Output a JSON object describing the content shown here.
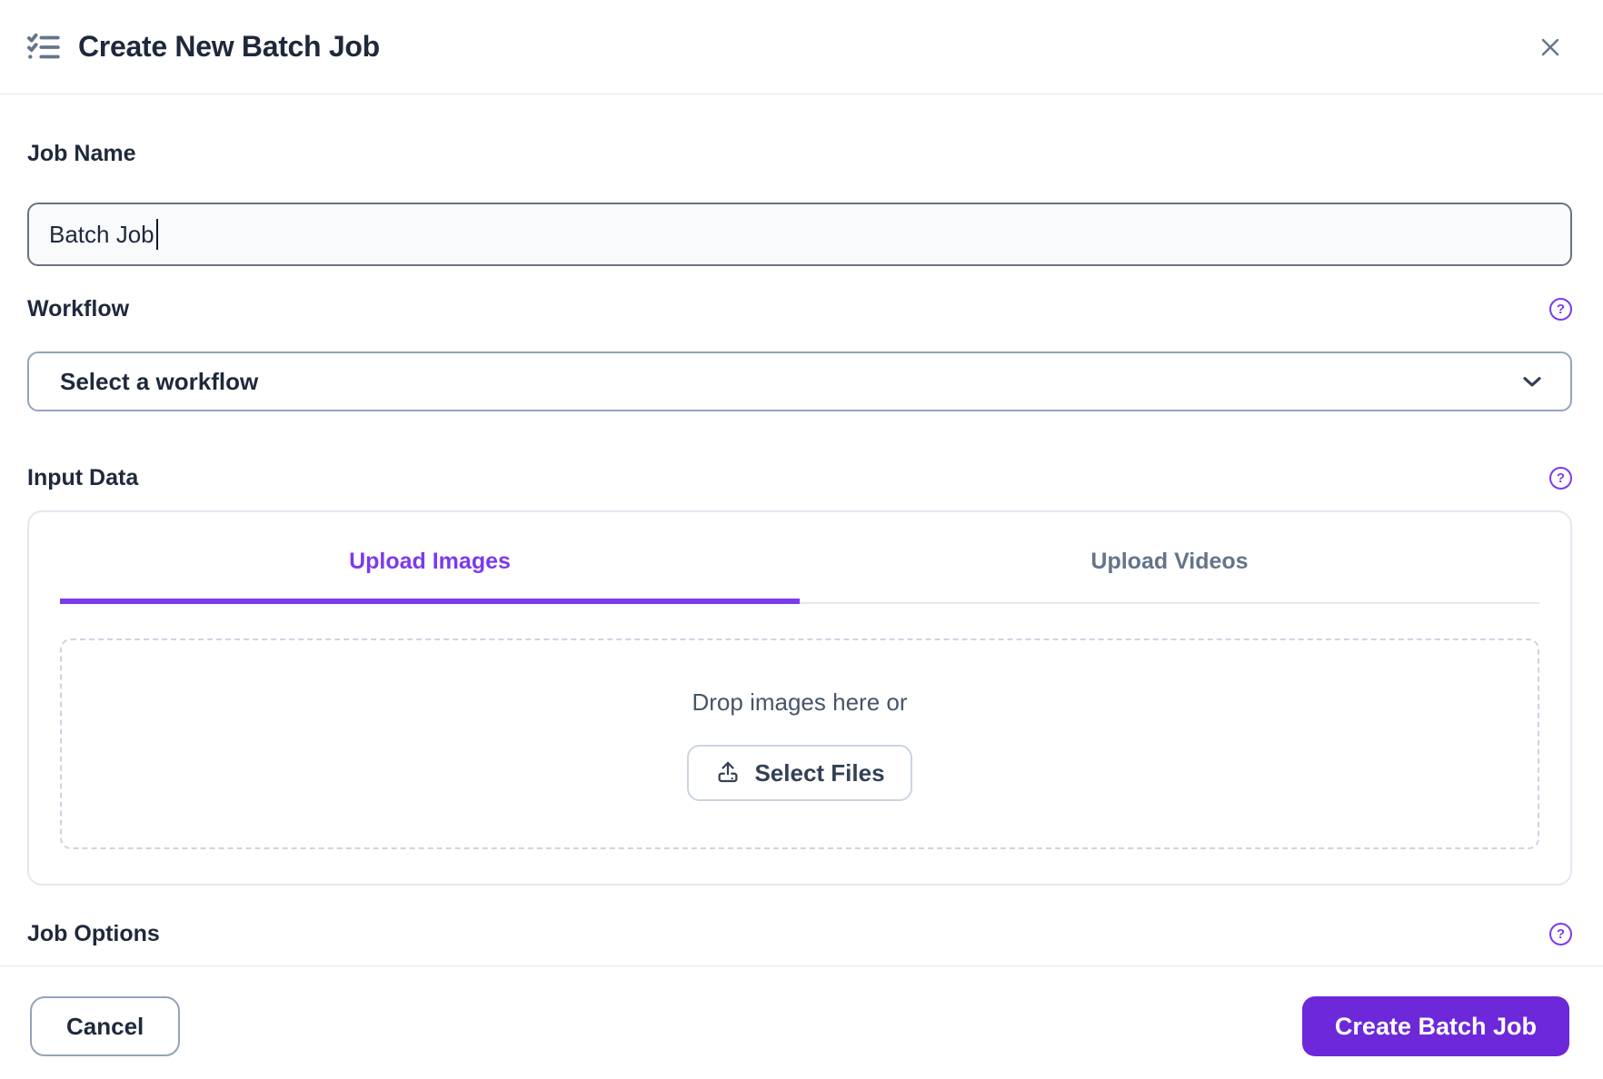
{
  "header": {
    "title": "Create New Batch Job",
    "icon": "task-list-icon",
    "close_icon": "close-icon"
  },
  "glyphs": {
    "help": "?"
  },
  "form": {
    "job_name": {
      "label": "Job Name",
      "value": "Batch Job"
    },
    "workflow": {
      "label": "Workflow",
      "selected_value": "Select a workflow"
    },
    "input_data": {
      "label": "Input Data",
      "tabs": [
        {
          "label": "Upload Images",
          "active": true
        },
        {
          "label": "Upload Videos",
          "active": false
        }
      ],
      "dropzone": {
        "prompt": "Drop images here or",
        "select_button_label": "Select Files",
        "select_button_icon": "upload-icon"
      }
    },
    "job_options": {
      "label": "Job Options"
    }
  },
  "footer": {
    "cancel_label": "Cancel",
    "submit_label": "Create Batch Job"
  },
  "colors": {
    "accent": "#7c3aed",
    "primary_button": "#6d28d9",
    "text_primary": "#1e293b",
    "text_secondary": "#475569",
    "input_background": "#f8fafc",
    "border_light": "#e2e8f0",
    "border_dashed": "#cbd5e1"
  }
}
